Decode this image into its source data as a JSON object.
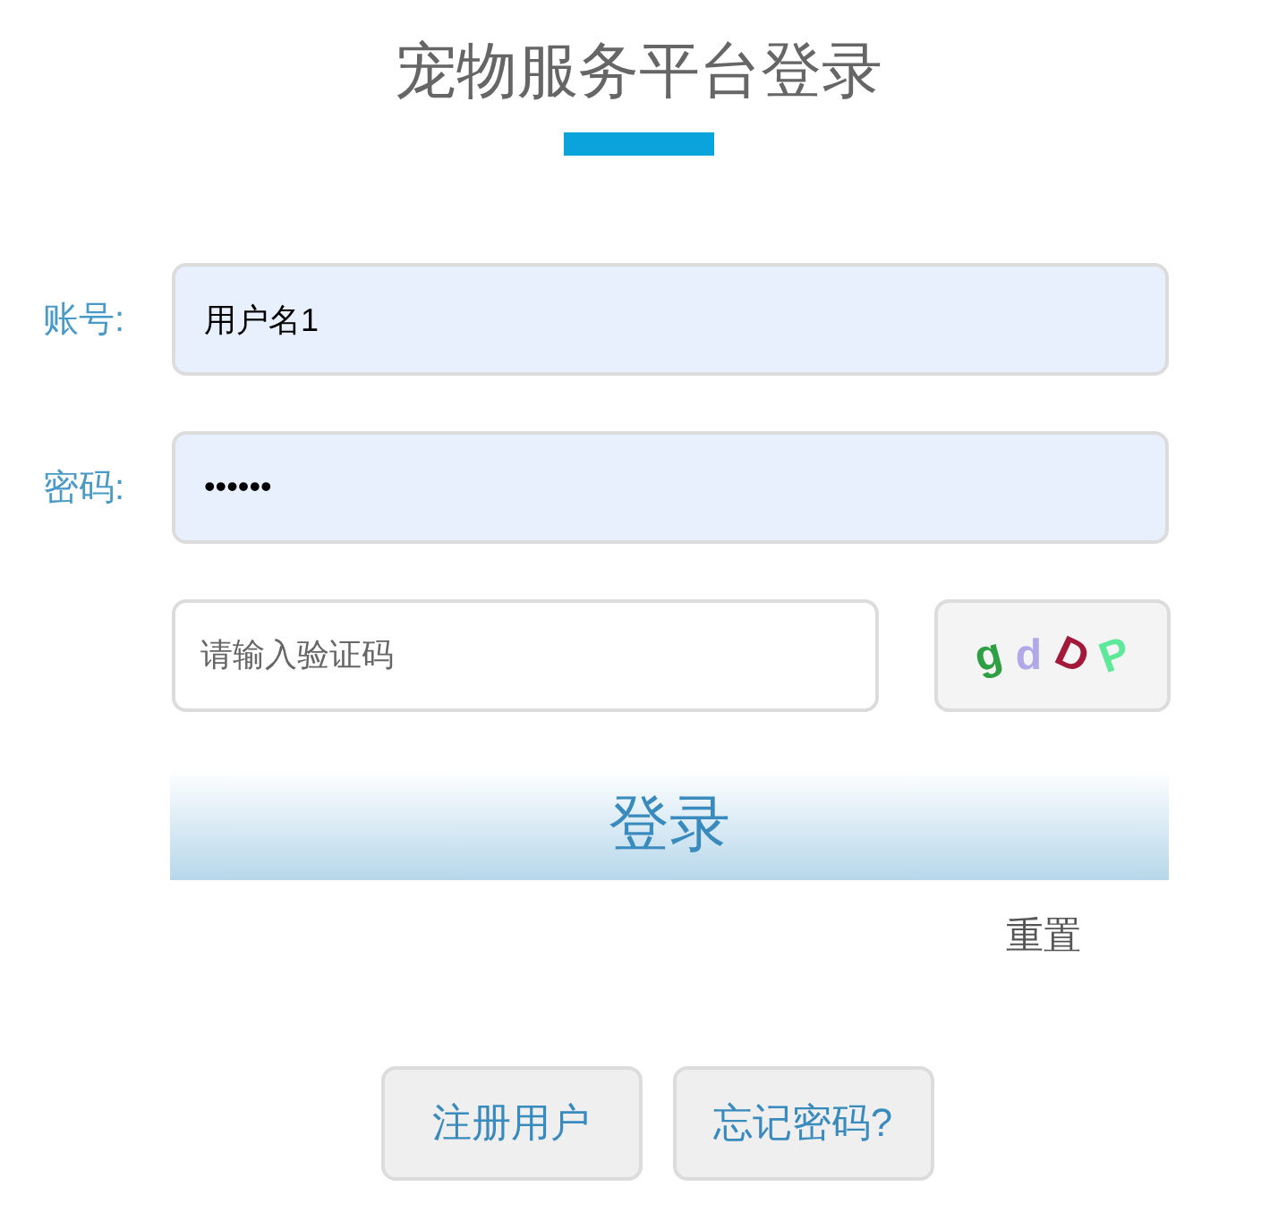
{
  "title": "宠物服务平台登录",
  "fields": [
    {
      "label": "账号:",
      "value": "用户名1"
    },
    {
      "label": "密码:",
      "value": "••••••"
    }
  ],
  "captcha": {
    "placeholder": "请输入验证码",
    "chars": [
      {
        "char": "g",
        "color": "#2ea043"
      },
      {
        "char": "d",
        "color": "#b0a8e8"
      },
      {
        "char": "D",
        "color": "#a3193a"
      },
      {
        "char": "P",
        "color": "#5ee89a"
      }
    ]
  },
  "login_button": "登录",
  "reset_link": "重置",
  "buttons": [
    "注册用户",
    "忘记密码?"
  ]
}
